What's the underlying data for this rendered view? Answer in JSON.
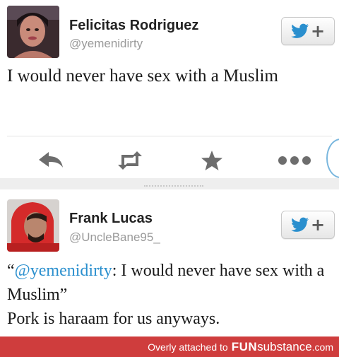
{
  "tweets": [
    {
      "display_name": "Felicitas Rodriguez",
      "handle": "@yemenidirty",
      "text": "I would never have sex with a Muslim",
      "follow_plus": "+"
    },
    {
      "display_name": "Frank Lucas",
      "handle": "@UncleBane95_",
      "quote_open": "“",
      "quote_mention": "@yemenidirty",
      "quote_body": ": I would never have sex with a Muslim”",
      "reply": "Pork is haraam for us anyways.",
      "follow_plus": "+"
    }
  ],
  "actions": {
    "icons": [
      "reply-icon",
      "retweet-icon",
      "favorite-icon",
      "more-icon"
    ]
  },
  "footer": {
    "credit": "Overly attached to",
    "brand_fun": "FUN",
    "brand_sub": "substance",
    "brand_com": ".com"
  },
  "colors": {
    "twitter_blue": "#2a8fce",
    "icon_gray": "#6d6d6d",
    "footer_red": "#cf3d3d",
    "handle_gray": "#9a9a9a"
  }
}
